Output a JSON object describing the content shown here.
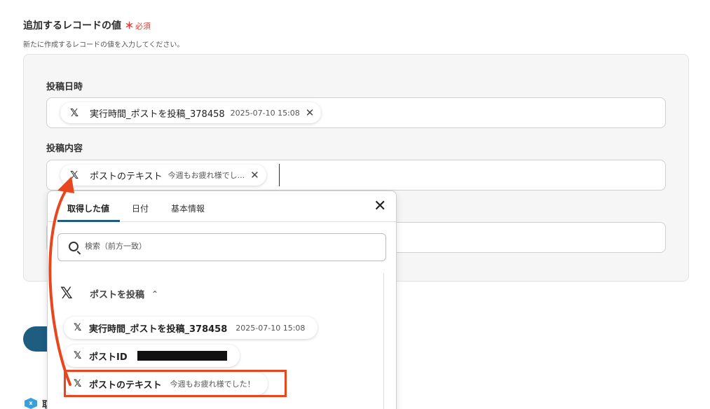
{
  "section": {
    "title": "追加するレコードの値",
    "required_mark": "＊",
    "required_label": "必須",
    "description": "新たに作成するレコードの値を入力してください。"
  },
  "fields": [
    {
      "label": "投稿日時",
      "chip": {
        "icon": "x-logo-icon",
        "label": "実行時間_ポストを投稿_378458",
        "value": "2025-07-10 15:08"
      }
    },
    {
      "label": "投稿内容",
      "chip": {
        "icon": "x-logo-icon",
        "label": "ポストのテキスト",
        "value": "今週もお疲れ様でし..."
      }
    }
  ],
  "dropdown": {
    "tabs": [
      "取得した値",
      "日付",
      "基本情報"
    ],
    "active_tab": 0,
    "search_placeholder": "検索（前方一致）",
    "group_title": "ポストを投稿",
    "items": [
      {
        "label": "実行時間_ポストを投稿_378458",
        "value": "2025-07-10 15:08"
      },
      {
        "label": "ポストID",
        "value": ""
      },
      {
        "label": "ポストのテキスト",
        "value": "今週もお疲れ様でした！"
      }
    ]
  },
  "background": {
    "partial_text": "取"
  },
  "icons": {
    "x_logo": "𝕏",
    "close": "✕",
    "chevron_up": "⌃",
    "bg_icon": "x"
  },
  "colors": {
    "accent": "#1e5c80",
    "required": "#e53935",
    "highlight": "#e8461e"
  }
}
